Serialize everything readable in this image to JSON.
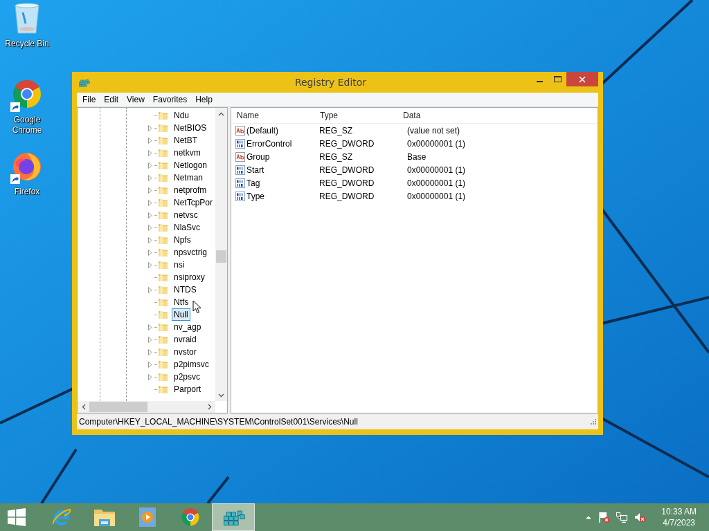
{
  "desktop_icons": [
    {
      "label": "Recycle Bin",
      "kind": "recycle"
    },
    {
      "label": "Google Chrome",
      "kind": "chrome"
    },
    {
      "label": "Firefox",
      "kind": "firefox"
    }
  ],
  "window": {
    "title": "Registry Editor",
    "menu": [
      "File",
      "Edit",
      "View",
      "Favorites",
      "Help"
    ],
    "tree": {
      "items": [
        {
          "label": "Ndu",
          "expandable": false,
          "selected": false
        },
        {
          "label": "NetBIOS",
          "expandable": true,
          "selected": false
        },
        {
          "label": "NetBT",
          "expandable": true,
          "selected": false
        },
        {
          "label": "netkvm",
          "expandable": true,
          "selected": false
        },
        {
          "label": "Netlogon",
          "expandable": true,
          "selected": false
        },
        {
          "label": "Netman",
          "expandable": true,
          "selected": false
        },
        {
          "label": "netprofm",
          "expandable": true,
          "selected": false
        },
        {
          "label": "NetTcpPor",
          "expandable": true,
          "selected": false
        },
        {
          "label": "netvsc",
          "expandable": true,
          "selected": false
        },
        {
          "label": "NlaSvc",
          "expandable": true,
          "selected": false
        },
        {
          "label": "Npfs",
          "expandable": true,
          "selected": false
        },
        {
          "label": "npsvctrig",
          "expandable": true,
          "selected": false
        },
        {
          "label": "nsi",
          "expandable": true,
          "selected": false
        },
        {
          "label": "nsiproxy",
          "expandable": false,
          "selected": false
        },
        {
          "label": "NTDS",
          "expandable": true,
          "selected": false
        },
        {
          "label": "Ntfs",
          "expandable": false,
          "selected": false
        },
        {
          "label": "Null",
          "expandable": false,
          "selected": true
        },
        {
          "label": "nv_agp",
          "expandable": true,
          "selected": false
        },
        {
          "label": "nvraid",
          "expandable": true,
          "selected": false
        },
        {
          "label": "nvstor",
          "expandable": true,
          "selected": false
        },
        {
          "label": "p2pimsvc",
          "expandable": true,
          "selected": false
        },
        {
          "label": "p2psvc",
          "expandable": true,
          "selected": false
        },
        {
          "label": "Parport",
          "expandable": false,
          "selected": false
        }
      ]
    },
    "values": {
      "columns": [
        "Name",
        "Type",
        "Data"
      ],
      "rows": [
        {
          "name": "(Default)",
          "type": "REG_SZ",
          "data": "(value not set)",
          "kind": "string"
        },
        {
          "name": "ErrorControl",
          "type": "REG_DWORD",
          "data": "0x00000001 (1)",
          "kind": "binary"
        },
        {
          "name": "Group",
          "type": "REG_SZ",
          "data": "Base",
          "kind": "string"
        },
        {
          "name": "Start",
          "type": "REG_DWORD",
          "data": "0x00000001 (1)",
          "kind": "binary"
        },
        {
          "name": "Tag",
          "type": "REG_DWORD",
          "data": "0x00000001 (1)",
          "kind": "binary"
        },
        {
          "name": "Type",
          "type": "REG_DWORD",
          "data": "0x00000001 (1)",
          "kind": "binary"
        }
      ]
    },
    "status_bar": "Computer\\HKEY_LOCAL_MACHINE\\SYSTEM\\ControlSet001\\Services\\Null"
  },
  "taskbar": {
    "items": [
      {
        "kind": "start",
        "selected": false
      },
      {
        "kind": "browser-e",
        "selected": false
      },
      {
        "kind": "folder",
        "selected": false
      },
      {
        "kind": "player",
        "selected": false
      },
      {
        "kind": "chrome",
        "selected": false
      },
      {
        "kind": "regedit",
        "selected": true
      }
    ],
    "clock": {
      "time": "10:33 AM",
      "date": "4/7/2023"
    }
  }
}
